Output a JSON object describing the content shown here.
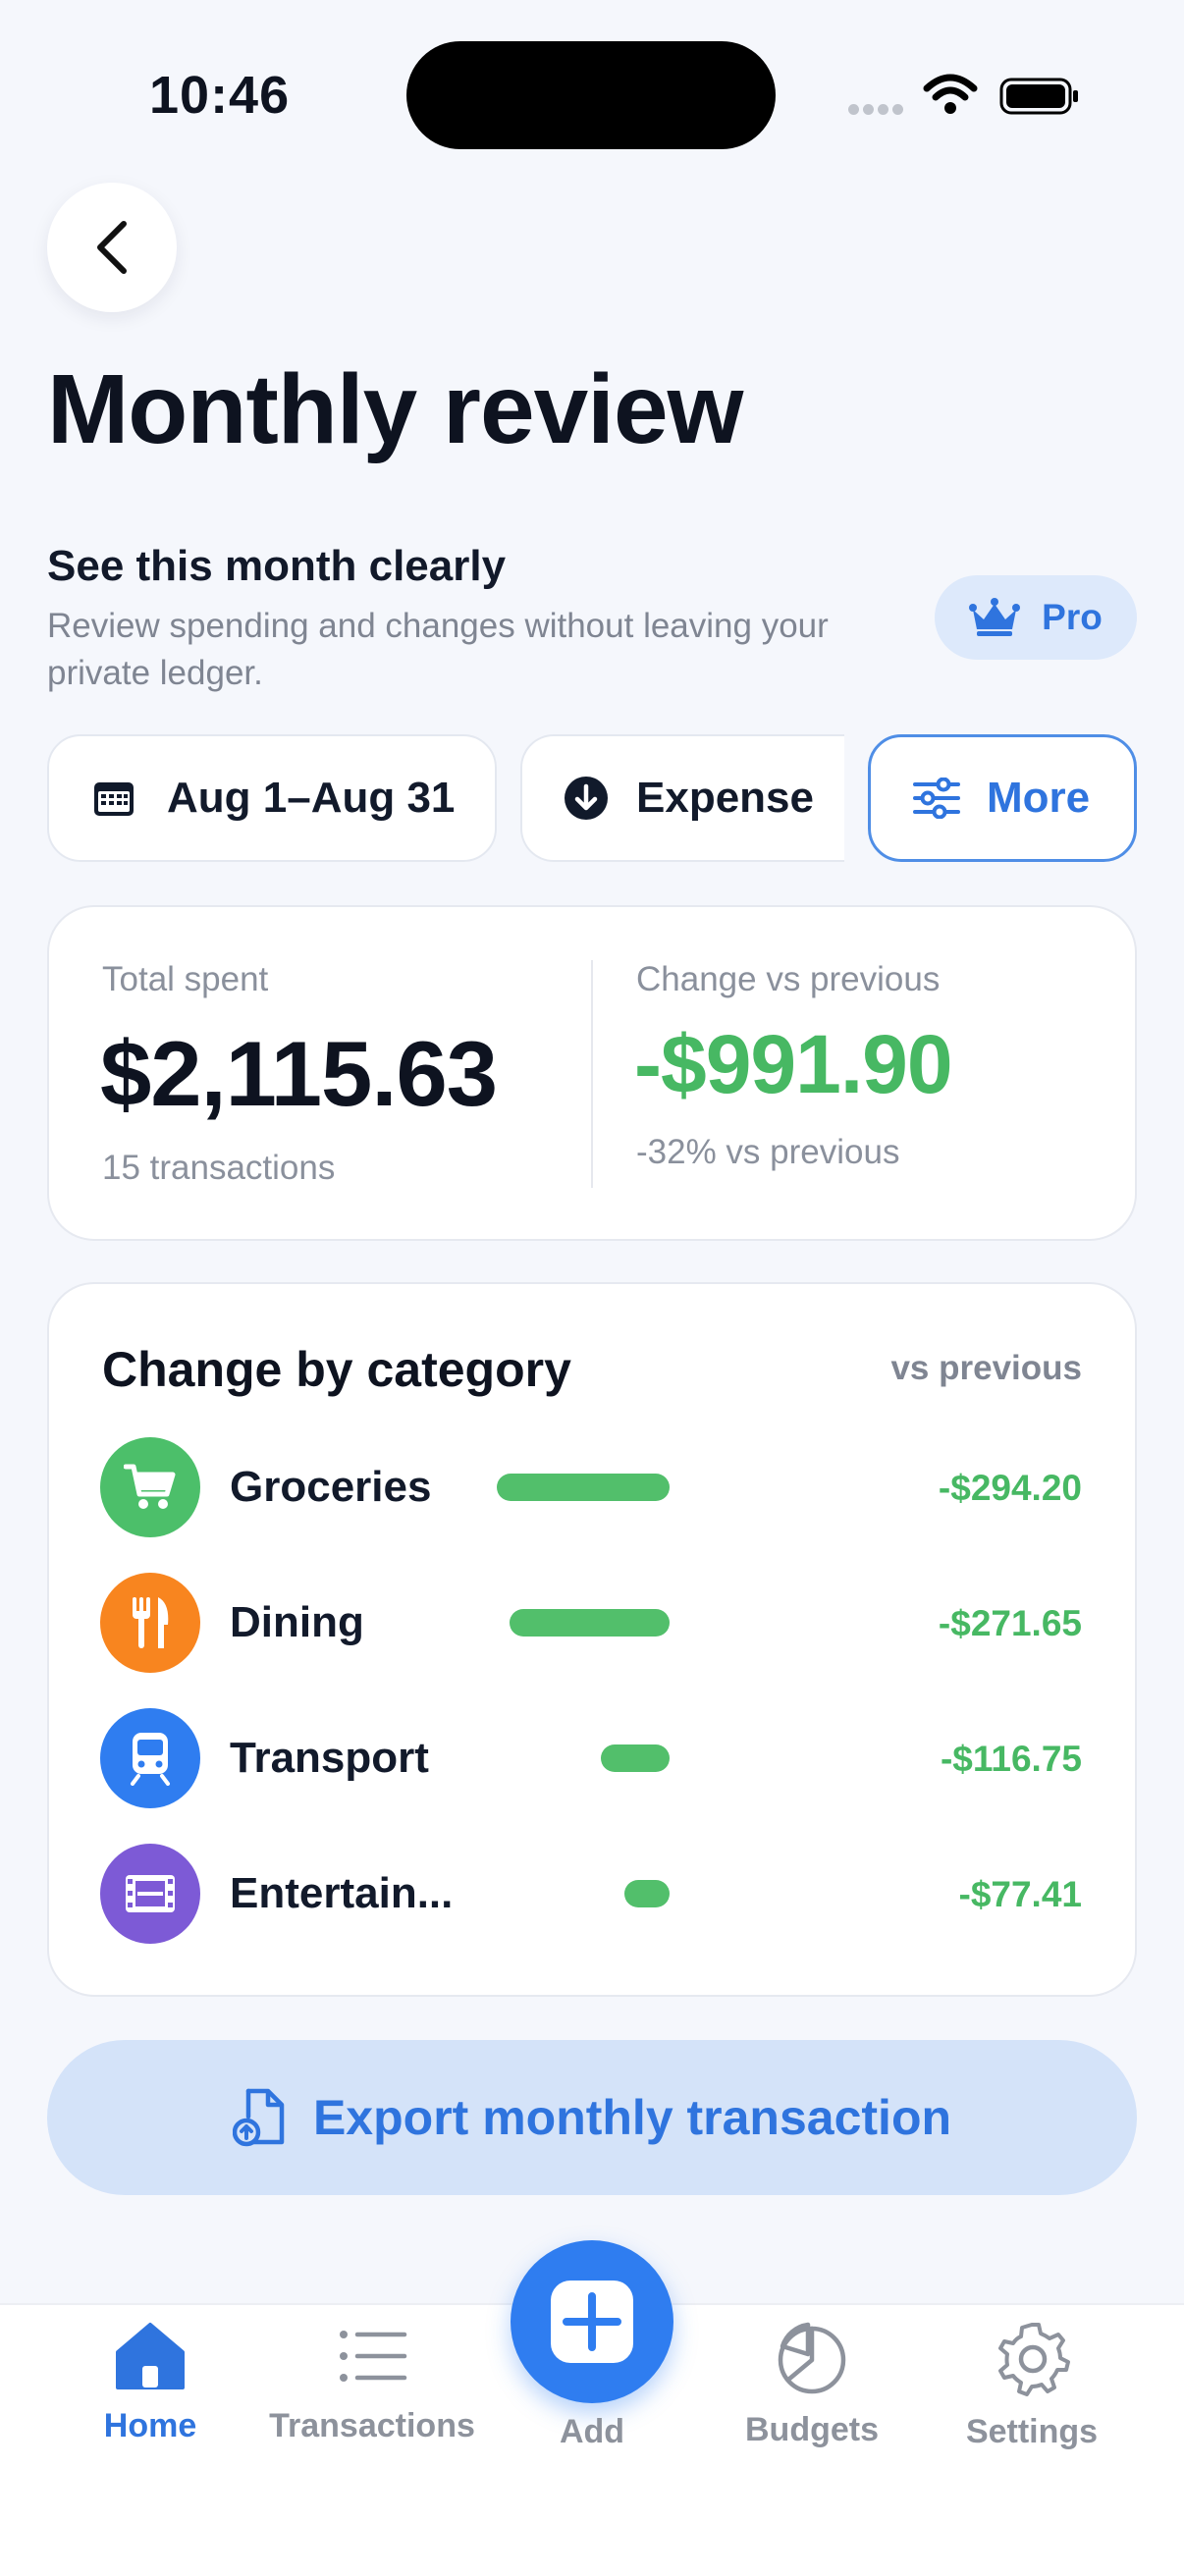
{
  "status": {
    "time": "10:46"
  },
  "header": {
    "title": "Monthly review",
    "subtitle": "See this month clearly",
    "description": "Review spending and changes without leaving your private ledger.",
    "pro_label": "Pro"
  },
  "filters": {
    "date_range": "Aug 1–Aug 31",
    "type": "Expense",
    "more": "More"
  },
  "summary": {
    "total_label": "Total spent",
    "total_value": "$2,115.63",
    "transactions": "15 transactions",
    "change_label": "Change vs previous",
    "change_value": "-$991.90",
    "change_percent": "-32% vs previous"
  },
  "categories": {
    "title": "Change by category",
    "vs_label": "vs previous",
    "items": [
      {
        "name": "Groceries",
        "value": "-$294.20",
        "amount": 294.2,
        "icon": "cart-icon",
        "color": "#4cbf6a"
      },
      {
        "name": "Dining",
        "value": "-$271.65",
        "amount": 271.65,
        "icon": "utensils-icon",
        "color": "#f8851f"
      },
      {
        "name": "Transport",
        "value": "-$116.75",
        "amount": 116.75,
        "icon": "train-icon",
        "color": "#2f7df0"
      },
      {
        "name": "Entertain...",
        "value": "-$77.41",
        "amount": 77.41,
        "icon": "film-icon",
        "color": "#7d5ad6"
      }
    ]
  },
  "export": {
    "label": "Export monthly transaction"
  },
  "tabbar": {
    "home": "Home",
    "transactions": "Transactions",
    "add": "Add",
    "budgets": "Budgets",
    "settings": "Settings"
  },
  "colors": {
    "accent": "#2f74de",
    "positive": "#47b863"
  }
}
